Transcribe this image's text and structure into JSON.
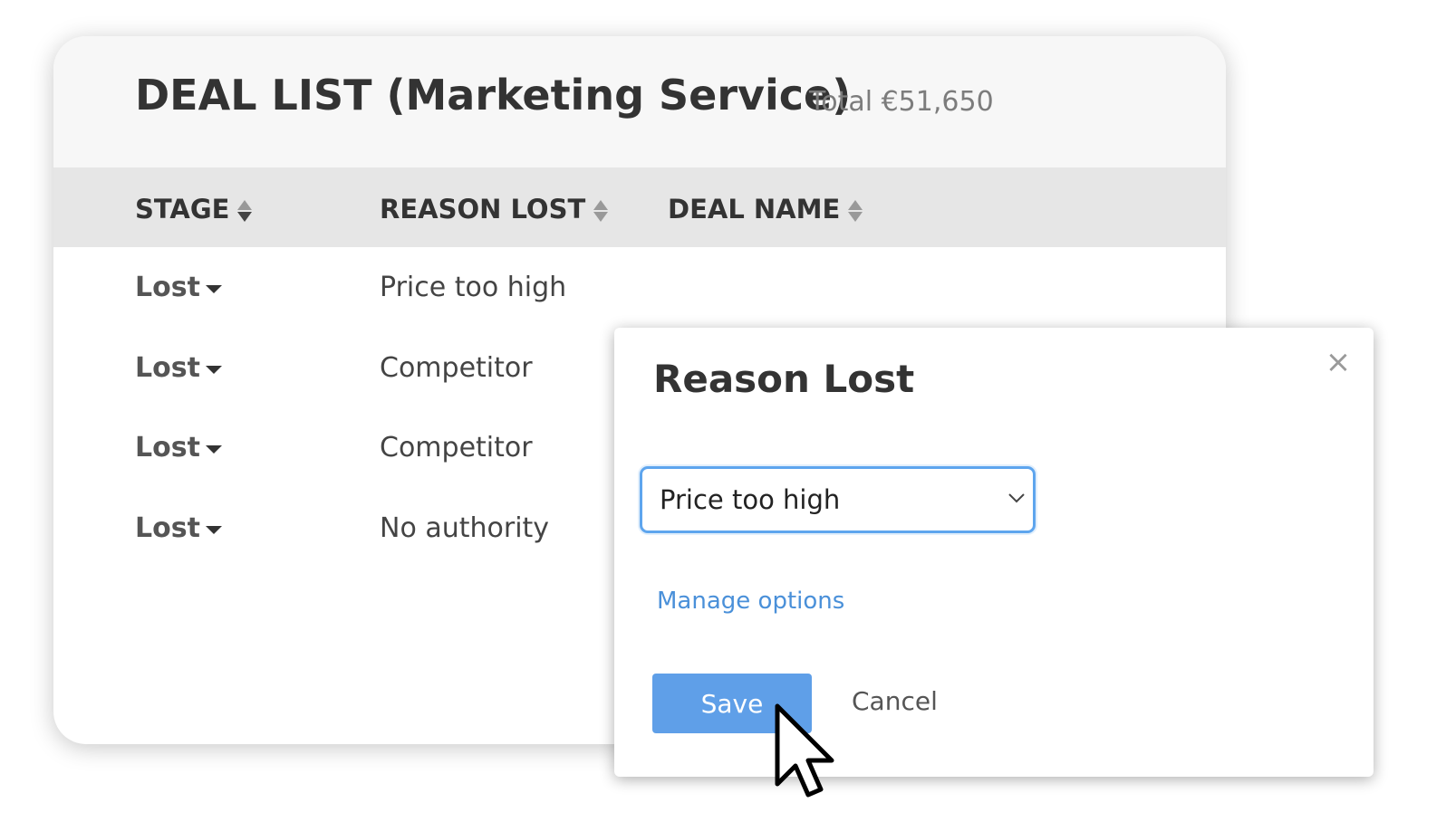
{
  "deal_list": {
    "title": "DEAL LIST (Marketing Service)",
    "total": "Total €51,650",
    "columns": [
      {
        "label": "STAGE"
      },
      {
        "label": "REASON LOST"
      },
      {
        "label": "DEAL NAME"
      }
    ],
    "rows": [
      {
        "stage": "Lost",
        "reason_lost": "Price too high"
      },
      {
        "stage": "Lost",
        "reason_lost": "Competitor"
      },
      {
        "stage": "Lost",
        "reason_lost": "Competitor"
      },
      {
        "stage": "Lost",
        "reason_lost": "No authority"
      }
    ]
  },
  "dialog": {
    "title": "Reason Lost",
    "close_icon": "×",
    "select_value": "Price too high",
    "manage_link": "Manage options",
    "save_label": "Save",
    "cancel_label": "Cancel"
  },
  "icons": {
    "sort": "sort-updown-icon",
    "stage_caret": "caret-down-icon",
    "select_chevron": "chevron-down-icon",
    "pointer": "mouse-pointer-icon"
  },
  "colors": {
    "accent_blue": "#5f9fe8",
    "link_blue": "#4a90d9",
    "focus_border": "#5ea5ee",
    "header_bg": "#f7f7f7",
    "table_head_bg": "#e6e6e6"
  }
}
